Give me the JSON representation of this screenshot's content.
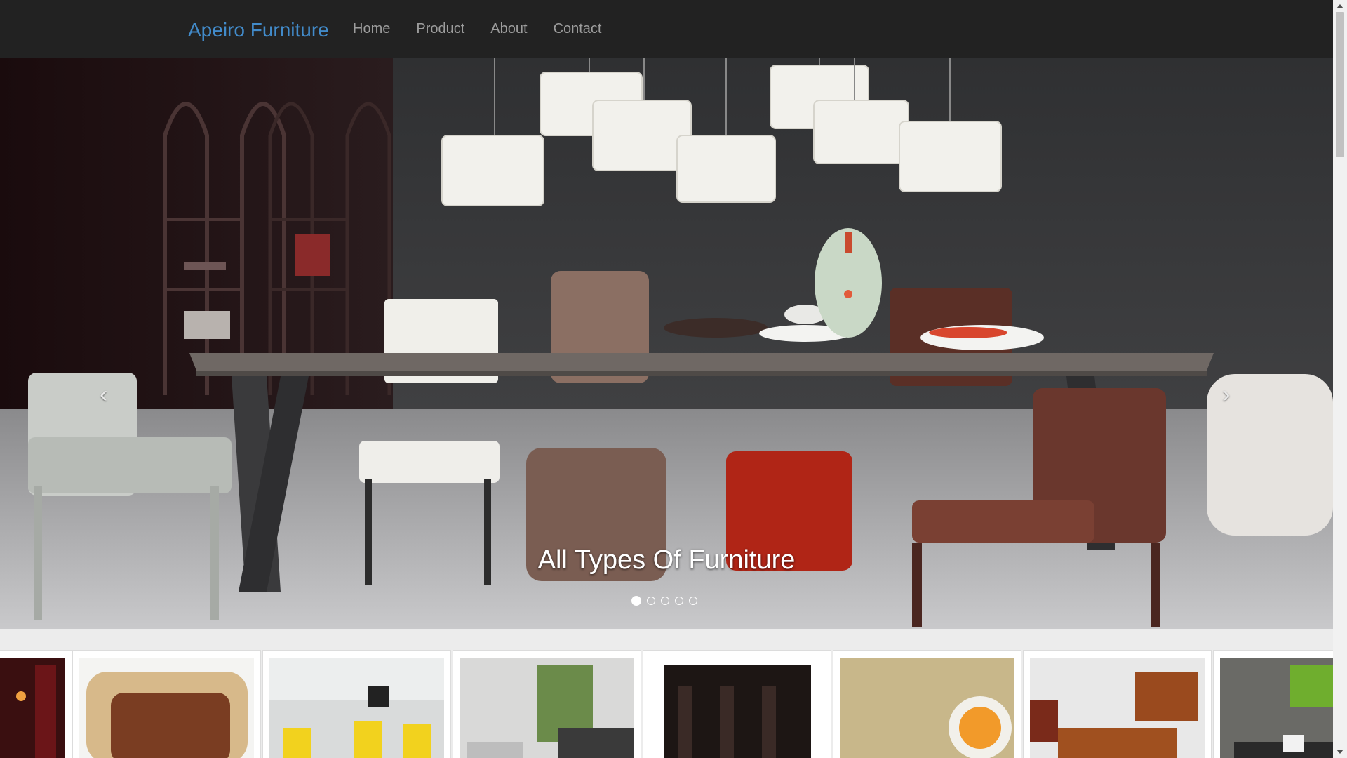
{
  "navbar": {
    "brand": "Apeiro Furniture",
    "items": [
      {
        "label": "Home"
      },
      {
        "label": "Product"
      },
      {
        "label": "About"
      },
      {
        "label": "Contact"
      }
    ]
  },
  "carousel": {
    "caption": "All Types Of Furniture",
    "prev_icon": "chevron-left-icon",
    "next_icon": "chevron-right-icon",
    "prev_glyph": "‹",
    "next_glyph": "›",
    "slide_count": 5,
    "active_slide": 1
  },
  "gallery": {
    "thumbnails": [
      {
        "name": "red-room-thumbnail"
      },
      {
        "name": "curved-wood-cabinet-thumbnail"
      },
      {
        "name": "yellow-office-thumbnail"
      },
      {
        "name": "living-room-thumbnail"
      },
      {
        "name": "dining-set-thumbnail"
      },
      {
        "name": "ball-chair-thumbnail"
      },
      {
        "name": "executive-office-thumbnail"
      },
      {
        "name": "green-lounge-thumbnail"
      }
    ]
  },
  "colors": {
    "navbar_bg": "#222222",
    "brand": "#428bca",
    "nav_link": "#9d9d9d",
    "page_bg": "#ececec"
  }
}
